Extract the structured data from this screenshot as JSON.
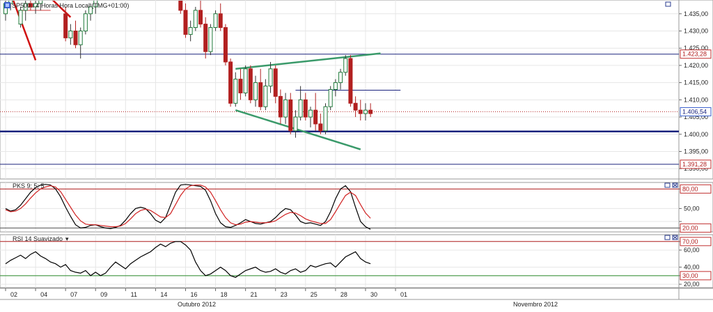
{
  "colors": {
    "up_candle": "#ffffff",
    "down_candle": "#b22020",
    "rsi_line": "#000000",
    "pks_k": "#000000",
    "pks_d": "#d02020",
    "price_level_dark": "#1a237e",
    "current_price": "#b22020",
    "trend_green": "#3a9a6a",
    "trend_red": "#d01010",
    "grid": "#e6e6e6"
  },
  "chart_data": [
    {
      "type": "candlestick",
      "title": "SP500.I 4 Horas Hora Local (TMG+01:00)",
      "ylim": [
        1387,
        1439
      ],
      "yticks": [
        1390,
        1395,
        1400,
        1405,
        1410,
        1415,
        1420,
        1425,
        1430,
        1435
      ],
      "ytick_labels": [
        "1.390,00",
        "1.395,00",
        "1.400,00",
        "1.405,00",
        "1.410,00",
        "1.415,00",
        "1.420,00",
        "1.425,00",
        "1.430,00",
        "1.435,00"
      ],
      "levels": [
        {
          "label": "1.423,28",
          "value": 1423.28,
          "style": "solid"
        },
        {
          "label": "1.406,54",
          "value": 1406.54,
          "style": "dotted"
        },
        {
          "label": "",
          "value": 1400.8,
          "style": "thick"
        },
        {
          "label": "1.391,28",
          "value": 1391.28,
          "style": "solid"
        }
      ],
      "candles": [
        {
          "i": 0,
          "o": 1435,
          "h": 1440,
          "l": 1433,
          "c": 1438
        },
        {
          "i": 1,
          "o": 1438,
          "h": 1442,
          "l": 1436,
          "c": 1440
        },
        {
          "i": 3,
          "o": 1432,
          "h": 1437,
          "l": 1431,
          "c": 1436
        },
        {
          "i": 4,
          "o": 1436,
          "h": 1439,
          "l": 1433,
          "c": 1438
        },
        {
          "i": 5,
          "o": 1438,
          "h": 1440,
          "l": 1436,
          "c": 1437
        },
        {
          "i": 6,
          "o": 1437,
          "h": 1439,
          "l": 1435,
          "c": 1438
        },
        {
          "i": 7,
          "o": 1438,
          "h": 1440,
          "l": 1436,
          "c": 1439
        },
        {
          "i": 12,
          "o": 1435,
          "h": 1437,
          "l": 1427,
          "c": 1428
        },
        {
          "i": 13,
          "o": 1428,
          "h": 1432,
          "l": 1426,
          "c": 1430
        },
        {
          "i": 14,
          "o": 1430,
          "h": 1433,
          "l": 1425,
          "c": 1426
        },
        {
          "i": 15,
          "o": 1426,
          "h": 1431,
          "l": 1422,
          "c": 1430
        },
        {
          "i": 16,
          "o": 1430,
          "h": 1436,
          "l": 1429,
          "c": 1435
        },
        {
          "i": 17,
          "o": 1435,
          "h": 1438,
          "l": 1433,
          "c": 1437
        },
        {
          "i": 18,
          "o": 1437,
          "h": 1440,
          "l": 1435,
          "c": 1439
        },
        {
          "i": 35,
          "o": 1440,
          "h": 1442,
          "l": 1435,
          "c": 1436
        },
        {
          "i": 36,
          "o": 1436,
          "h": 1438,
          "l": 1428,
          "c": 1429
        },
        {
          "i": 37,
          "o": 1429,
          "h": 1433,
          "l": 1427,
          "c": 1431
        },
        {
          "i": 38,
          "o": 1431,
          "h": 1437,
          "l": 1430,
          "c": 1436
        },
        {
          "i": 39,
          "o": 1436,
          "h": 1439,
          "l": 1431,
          "c": 1432
        },
        {
          "i": 40,
          "o": 1432,
          "h": 1434,
          "l": 1422,
          "c": 1424
        },
        {
          "i": 41,
          "o": 1424,
          "h": 1432,
          "l": 1423,
          "c": 1431
        },
        {
          "i": 42,
          "o": 1431,
          "h": 1436,
          "l": 1430,
          "c": 1435
        },
        {
          "i": 43,
          "o": 1435,
          "h": 1438,
          "l": 1430,
          "c": 1431
        },
        {
          "i": 44,
          "o": 1431,
          "h": 1432,
          "l": 1420,
          "c": 1421
        },
        {
          "i": 45,
          "o": 1421,
          "h": 1422,
          "l": 1408,
          "c": 1409
        },
        {
          "i": 46,
          "o": 1409,
          "h": 1418,
          "l": 1408,
          "c": 1416
        },
        {
          "i": 47,
          "o": 1416,
          "h": 1419,
          "l": 1410,
          "c": 1412
        },
        {
          "i": 48,
          "o": 1412,
          "h": 1420,
          "l": 1411,
          "c": 1419
        },
        {
          "i": 49,
          "o": 1419,
          "h": 1420,
          "l": 1409,
          "c": 1410
        },
        {
          "i": 50,
          "o": 1410,
          "h": 1417,
          "l": 1408,
          "c": 1415
        },
        {
          "i": 51,
          "o": 1415,
          "h": 1419,
          "l": 1407,
          "c": 1408
        },
        {
          "i": 52,
          "o": 1408,
          "h": 1416,
          "l": 1407,
          "c": 1414
        },
        {
          "i": 53,
          "o": 1414,
          "h": 1421,
          "l": 1412,
          "c": 1419
        },
        {
          "i": 54,
          "o": 1419,
          "h": 1420,
          "l": 1409,
          "c": 1411
        },
        {
          "i": 55,
          "o": 1411,
          "h": 1413,
          "l": 1403,
          "c": 1405
        },
        {
          "i": 56,
          "o": 1405,
          "h": 1412,
          "l": 1403,
          "c": 1410
        },
        {
          "i": 57,
          "o": 1410,
          "h": 1412,
          "l": 1400,
          "c": 1401
        },
        {
          "i": 58,
          "o": 1401,
          "h": 1407,
          "l": 1399,
          "c": 1405
        },
        {
          "i": 59,
          "o": 1405,
          "h": 1414,
          "l": 1404,
          "c": 1410
        },
        {
          "i": 60,
          "o": 1410,
          "h": 1412,
          "l": 1404,
          "c": 1405
        },
        {
          "i": 61,
          "o": 1405,
          "h": 1408,
          "l": 1402,
          "c": 1407
        },
        {
          "i": 62,
          "o": 1407,
          "h": 1412,
          "l": 1401,
          "c": 1403
        },
        {
          "i": 63,
          "o": 1403,
          "h": 1406,
          "l": 1400,
          "c": 1401
        },
        {
          "i": 64,
          "o": 1401,
          "h": 1409,
          "l": 1400,
          "c": 1408
        },
        {
          "i": 65,
          "o": 1408,
          "h": 1414,
          "l": 1407,
          "c": 1413
        },
        {
          "i": 66,
          "o": 1413,
          "h": 1416,
          "l": 1411,
          "c": 1415
        },
        {
          "i": 67,
          "o": 1415,
          "h": 1419,
          "l": 1413,
          "c": 1418
        },
        {
          "i": 68,
          "o": 1418,
          "h": 1423,
          "l": 1417,
          "c": 1422
        },
        {
          "i": 69,
          "o": 1422,
          "h": 1423,
          "l": 1408,
          "c": 1409
        },
        {
          "i": 70,
          "o": 1409,
          "h": 1411,
          "l": 1405,
          "c": 1407
        },
        {
          "i": 71,
          "o": 1407,
          "h": 1410,
          "l": 1404,
          "c": 1406
        },
        {
          "i": 72,
          "o": 1406,
          "h": 1409,
          "l": 1404,
          "c": 1407
        },
        {
          "i": 73,
          "o": 1407,
          "h": 1409,
          "l": 1405,
          "c": 1406
        }
      ],
      "trendlines": [
        {
          "color": "green",
          "from": [
            46,
            1419
          ],
          "to": [
            75,
            1423.5
          ]
        },
        {
          "color": "green",
          "from": [
            46,
            1407
          ],
          "to": [
            71,
            1395.6
          ]
        },
        {
          "color": "red",
          "from": [
            1,
            1441
          ],
          "to": [
            6,
            1421.5
          ]
        },
        {
          "color": "red",
          "from": [
            8,
            1441
          ],
          "to": [
            13,
            1434
          ]
        },
        {
          "color": "navy",
          "from": [
            58,
            1412.8
          ],
          "to": [
            79,
            1412.8
          ]
        }
      ]
    },
    {
      "type": "line",
      "title": "PKS 9; 5; 5",
      "ylim": [
        14,
        90
      ],
      "yticks": [
        20,
        30,
        50,
        80
      ],
      "ytick_labels": [
        "20,00",
        "",
        "50,00",
        "80,00"
      ],
      "levels": [
        {
          "label": "80,00",
          "value": 80
        },
        {
          "label": "20,00",
          "value": 20
        }
      ],
      "series": [
        {
          "color": "black",
          "values": [
            50,
            46,
            48,
            55,
            65,
            75,
            82,
            86,
            87,
            86,
            80,
            68,
            52,
            38,
            25,
            20,
            21,
            24,
            25,
            22,
            20,
            19,
            21,
            24,
            32,
            42,
            50,
            52,
            50,
            42,
            32,
            28,
            36,
            55,
            75,
            86,
            87,
            86,
            85,
            84,
            78,
            62,
            42,
            28,
            22,
            21,
            24,
            28,
            33,
            30,
            27,
            26,
            28,
            30,
            36,
            44,
            50,
            48,
            40,
            30,
            27,
            28,
            26,
            24,
            30,
            45,
            65,
            80,
            85,
            76,
            52,
            30,
            22,
            18
          ]
        },
        {
          "color": "red",
          "values": [
            48,
            45,
            46,
            50,
            57,
            66,
            74,
            80,
            83,
            85,
            83,
            76,
            64,
            52,
            40,
            31,
            26,
            25,
            25,
            24,
            23,
            22,
            22,
            23,
            27,
            34,
            42,
            47,
            49,
            47,
            42,
            37,
            36,
            42,
            56,
            70,
            80,
            85,
            86,
            86,
            83,
            75,
            62,
            48,
            36,
            28,
            25,
            26,
            29,
            30,
            29,
            28,
            28,
            29,
            31,
            36,
            41,
            44,
            43,
            39,
            34,
            31,
            29,
            27,
            27,
            33,
            45,
            58,
            70,
            75,
            70,
            56,
            43,
            35
          ]
        }
      ]
    },
    {
      "type": "line",
      "title": "RSI 14 Suavizado",
      "ylim": [
        16,
        78
      ],
      "yticks": [
        20,
        30,
        40,
        60,
        70
      ],
      "ytick_labels": [
        "20,00",
        "",
        "40,00",
        "60,00",
        ""
      ],
      "levels": [
        {
          "label": "70,00",
          "value": 70
        },
        {
          "label": "30,00",
          "value": 30
        }
      ],
      "series": [
        {
          "color": "black",
          "values": [
            44,
            48,
            51,
            54,
            50,
            55,
            58,
            53,
            50,
            46,
            44,
            40,
            43,
            36,
            34,
            33,
            36,
            30,
            34,
            30,
            33,
            40,
            46,
            42,
            38,
            44,
            48,
            52,
            55,
            58,
            63,
            67,
            64,
            68,
            70,
            70,
            66,
            60,
            46,
            36,
            30,
            32,
            36,
            40,
            36,
            30,
            28,
            32,
            36,
            38,
            40,
            36,
            34,
            35,
            38,
            34,
            32,
            36,
            38,
            34,
            36,
            42,
            40,
            42,
            44,
            45,
            40,
            46,
            52,
            55,
            58,
            50,
            46,
            44
          ]
        }
      ]
    }
  ],
  "x_axis": {
    "ticks": [
      {
        "label": "02",
        "i": 0
      },
      {
        "label": "04",
        "i": 6
      },
      {
        "label": "07",
        "i": 12
      },
      {
        "label": "09",
        "i": 18
      },
      {
        "label": "11",
        "i": 24
      },
      {
        "label": "14",
        "i": 30
      },
      {
        "label": "16",
        "i": 36
      },
      {
        "label": "18",
        "i": 42
      },
      {
        "label": "21",
        "i": 48
      },
      {
        "label": "23",
        "i": 54
      },
      {
        "label": "25",
        "i": 60
      },
      {
        "label": "28",
        "i": 66
      },
      {
        "label": "30",
        "i": 72
      },
      {
        "label": "01",
        "i": 78
      }
    ],
    "months": [
      "Outubro 2012",
      "Novembro 2012"
    ]
  }
}
